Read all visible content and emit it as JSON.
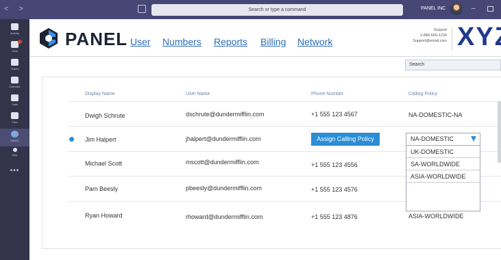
{
  "titlebar": {
    "arrows": "< >",
    "search_placeholder": "Search or type a command",
    "org_name": "PANEL INC",
    "minimize": "–"
  },
  "rail": {
    "items": [
      {
        "label": "Activity",
        "icon": "bell-icon"
      },
      {
        "label": "Chat",
        "icon": "chat-icon"
      },
      {
        "label": "Teams",
        "icon": "teams-icon"
      },
      {
        "label": "Calendar",
        "icon": "calendar-icon"
      },
      {
        "label": "Calls",
        "icon": "phone-icon"
      },
      {
        "label": "Files",
        "icon": "file-icon"
      },
      {
        "label": "PANEL",
        "icon": "panel-app-icon"
      },
      {
        "label": "Help",
        "icon": "help-icon"
      }
    ],
    "more": "•••"
  },
  "brand": {
    "name": "PANEL",
    "partner_logo": "XYZ",
    "support_title": "Support",
    "support_phone": "1-888-500-1234",
    "support_email": "Support@email.com"
  },
  "nav": [
    "User",
    "Numbers",
    "Reports",
    "Billing",
    "Network"
  ],
  "search": {
    "placeholder": "Search"
  },
  "table": {
    "headers": [
      "Display Name",
      "User Name",
      "Phone Number",
      "Calling Policy"
    ],
    "rows": [
      {
        "name": "Dwigh Schrute",
        "user": "dschrute@dundermifflin.com",
        "phone": "+1 555 123 4567",
        "policy": "NA-DOMESTIC-NA"
      },
      {
        "name": "Jim Halpert",
        "user": "jhalpert@dundermifflin.com",
        "phone": "",
        "policy": "NA-DOMESTIC"
      },
      {
        "name": "Michael Scott",
        "user": "mscott@dundermifflin.com",
        "phone": "+1 555 123 4556",
        "policy": ""
      },
      {
        "name": "Pam Beesly",
        "user": "pbeesly@dundermifflin.com",
        "phone": "+1 555 123 4576",
        "policy": ""
      },
      {
        "name": "Ryan Howard",
        "user": "rhoward@dundermifflin.com",
        "phone": "+1 555 123 4876",
        "policy": "ASIA-WORLDWIDE"
      }
    ],
    "assign_button": "Assign Calling Policy"
  },
  "dropdown": {
    "selected": "NA-DOMESTIC",
    "options": [
      "UK-DOMESTIC",
      "SA-WORLDWIDE",
      "ASIA-WORLDWIDE"
    ]
  },
  "colors": {
    "titlebar": "#464775",
    "rail": "#33344a",
    "accent": "#2b8dd6",
    "link": "#2c6db3"
  }
}
